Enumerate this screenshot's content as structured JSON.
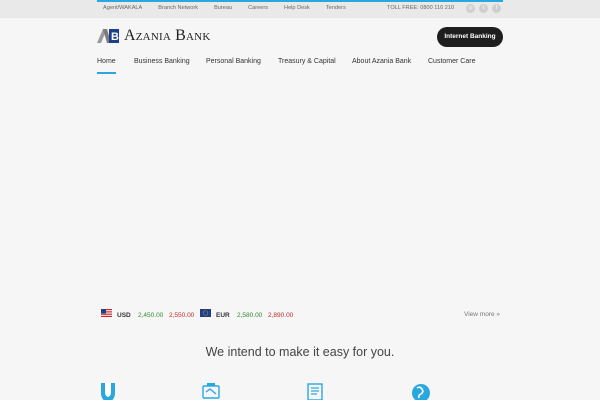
{
  "topbar": {
    "links": [
      "Agent/WAKALA",
      "Branch Network",
      "Bureau",
      "Careers",
      "Help Desk",
      "Tenders"
    ],
    "tollfree": "TOLL FREE: 0800 110 210",
    "social_icons": [
      "instagram-icon",
      "twitter-icon",
      "facebook-icon"
    ]
  },
  "header": {
    "logo_text": "Azania Bank",
    "internet_banking": "Internet Banking"
  },
  "nav": {
    "items": [
      "Home",
      "Business Banking",
      "Personal Banking",
      "Treasury & Capital",
      "About Azania Bank",
      "Customer Care"
    ],
    "active": "Home"
  },
  "rates": {
    "usd": {
      "code": "USD",
      "buy": "2,450.00",
      "sell": "2,550.00"
    },
    "eur": {
      "code": "EUR",
      "buy": "2,580.00",
      "sell": "2,890.00"
    },
    "view_more": "View more »"
  },
  "tagline": "We intend to make it easy for you.",
  "services_icons": [
    "shield-icon",
    "handshake-icon",
    "document-icon",
    "globe-icon"
  ],
  "colors": {
    "accent": "#29a8e0",
    "buy": "#2e8b2e",
    "sell": "#c62828",
    "dark_button": "#1e1e1e"
  }
}
